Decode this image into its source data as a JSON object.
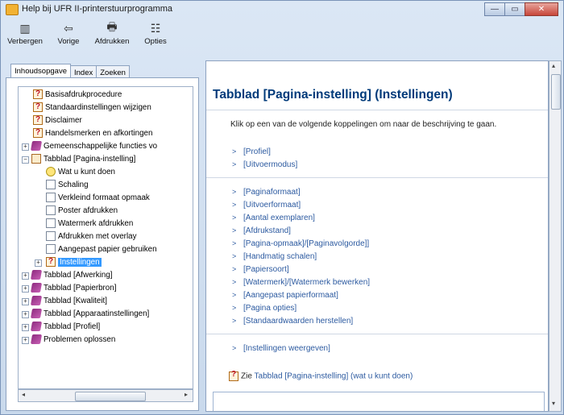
{
  "window": {
    "title": "Help bij UFR II-printerstuurprogramma"
  },
  "toolbar": {
    "hide": "Verbergen",
    "back": "Vorige",
    "print": "Afdrukken",
    "options": "Opties"
  },
  "tabs": [
    "Inhoudsopgave",
    "Index",
    "Zoeken"
  ],
  "tree": [
    {
      "label": "Basisafdrukprocedure",
      "icon": "help-page-icon"
    },
    {
      "label": "Standaardinstellingen wijzigen",
      "icon": "help-page-icon"
    },
    {
      "label": "Disclaimer",
      "icon": "help-page-icon"
    },
    {
      "label": "Handelsmerken en afkortingen",
      "icon": "help-page-icon"
    },
    {
      "label": "Gemeenschappelijke functies vo",
      "icon": "book-icon"
    },
    {
      "label": "Tabblad [Pagina-instelling]",
      "icon": "open-book-icon"
    },
    {
      "label": "Wat u kunt doen",
      "icon": "help-page-icon"
    },
    {
      "label": "Schaling",
      "icon": "page-icon"
    },
    {
      "label": "Verkleind formaat opmaak",
      "icon": "page-icon"
    },
    {
      "label": "Poster afdrukken",
      "icon": "page-icon"
    },
    {
      "label": "Watermerk afdrukken",
      "icon": "page-icon"
    },
    {
      "label": "Afdrukken met overlay",
      "icon": "page-icon"
    },
    {
      "label": "Aangepast papier gebruiken",
      "icon": "page-icon"
    },
    {
      "label": "Instellingen",
      "icon": "help-page-icon"
    },
    {
      "label": "Tabblad [Afwerking]",
      "icon": "book-icon"
    },
    {
      "label": "Tabblad [Papierbron]",
      "icon": "book-icon"
    },
    {
      "label": "Tabblad [Kwaliteit]",
      "icon": "book-icon"
    },
    {
      "label": "Tabblad [Apparaatinstellingen]",
      "icon": "book-icon"
    },
    {
      "label": "Tabblad [Profiel]",
      "icon": "book-icon"
    },
    {
      "label": "Problemen oplossen",
      "icon": "book-icon"
    }
  ],
  "content": {
    "heading": "Tabblad [Pagina-instelling] (Instellingen)",
    "intro": "Klik op een van de volgende koppelingen om naar de beschrijving te gaan.",
    "links_group1": [
      "[Profiel]",
      "[Uitvoermodus]"
    ],
    "links_group2": [
      "[Paginaformaat]",
      "[Uitvoerformaat]",
      "[Aantal exemplaren]",
      "[Afdrukstand]",
      "[Pagina-opmaak]/[Paginavolgorde]]",
      "[Handmatig schalen]",
      "[Papiersoort]",
      "[Watermerk]/[Watermerk bewerken]",
      "[Aangepast papierformaat]",
      "[Pagina opties]",
      "[Standaardwaarden herstellen]"
    ],
    "links_group3": [
      "[Instellingen weergeven]"
    ],
    "tip_prefix": "Zie",
    "tip_link": "Tabblad [Pagina-instelling] (wat u kunt doen)"
  }
}
